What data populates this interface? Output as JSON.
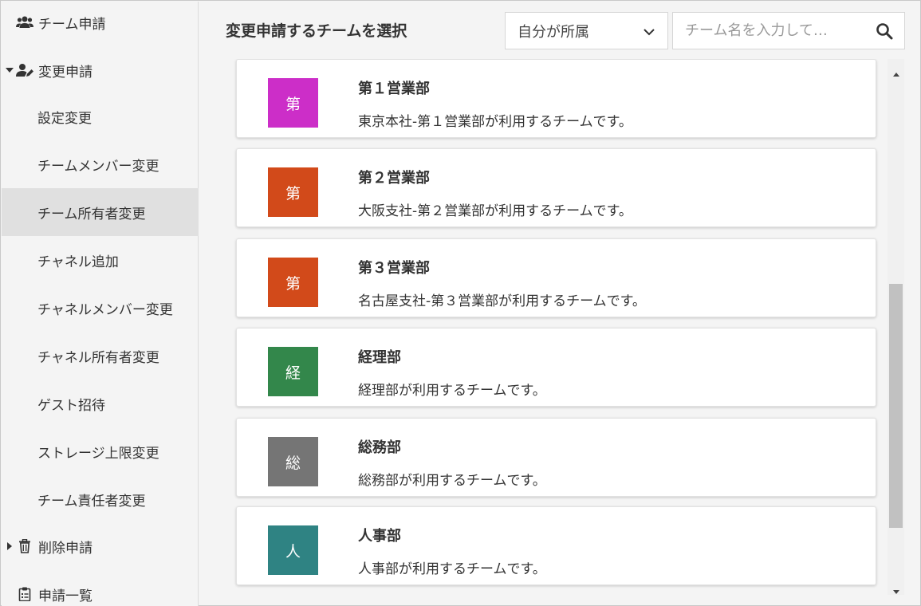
{
  "sidebar": {
    "items": [
      {
        "label": "チーム申請"
      },
      {
        "label": "変更申請"
      },
      {
        "label": "設定変更"
      },
      {
        "label": "チームメンバー変更"
      },
      {
        "label": "チーム所有者変更"
      },
      {
        "label": "チャネル追加"
      },
      {
        "label": "チャネルメンバー変更"
      },
      {
        "label": "チャネル所有者変更"
      },
      {
        "label": "ゲスト招待"
      },
      {
        "label": "ストレージ上限変更"
      },
      {
        "label": "チーム責任者変更"
      },
      {
        "label": "削除申請"
      },
      {
        "label": "申請一覧"
      }
    ]
  },
  "main": {
    "title": "変更申請するチームを選択",
    "filter": {
      "value": "自分が所属"
    },
    "search": {
      "placeholder": "チーム名を入力して…"
    }
  },
  "teams": [
    {
      "initial": "第",
      "name": "第１営業部",
      "description": "東京本社-第１営業部が利用するチームです。",
      "color": "#cc2ec8"
    },
    {
      "initial": "第",
      "name": "第２営業部",
      "description": "大阪支社-第２営業部が利用するチームです。",
      "color": "#d24a1a"
    },
    {
      "initial": "第",
      "name": "第３営業部",
      "description": "名古屋支社-第３営業部が利用するチームです。",
      "color": "#d24a1a"
    },
    {
      "initial": "経",
      "name": "経理部",
      "description": "経理部が利用するチームです。",
      "color": "#33874b"
    },
    {
      "initial": "総",
      "name": "総務部",
      "description": "総務部が利用するチームです。",
      "color": "#757575"
    },
    {
      "initial": "人",
      "name": "人事部",
      "description": "人事部が利用するチームです。",
      "color": "#2f8383"
    }
  ]
}
